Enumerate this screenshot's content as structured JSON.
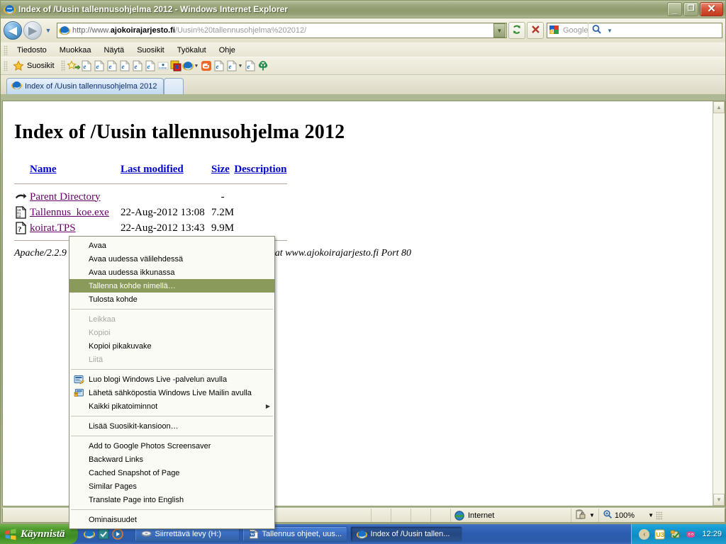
{
  "window": {
    "title": "Index of /Uusin tallennusohjelma 2012 - Windows Internet Explorer",
    "minimize_label": "_",
    "maximize_label": "❐",
    "close_label": "✕"
  },
  "nav": {
    "back_label": "◀",
    "forward_label": "▶",
    "history_caret": "▼",
    "address_prefix": "http://www.",
    "address_domain": "ajokoirajarjesto.fi",
    "address_path": "/Uusin%20tallennusohjelma%202012/",
    "address_dropdown_caret": "▼",
    "refresh_icon": "refresh-icon",
    "stop_icon": "stop-icon",
    "search_placeholder": "Google",
    "search_go_caret": "▼"
  },
  "menubar": {
    "items": [
      {
        "label": "Tiedosto"
      },
      {
        "label": "Muokkaa"
      },
      {
        "label": "Näytä"
      },
      {
        "label": "Suosikit"
      },
      {
        "label": "Työkalut"
      },
      {
        "label": "Ohje"
      }
    ]
  },
  "favbar": {
    "label": "Suosikit",
    "star_icon": "star-icon",
    "items": [
      {
        "icon": "add-favorites-icon"
      },
      {
        "icon": "ie-page-icon"
      },
      {
        "icon": "ie-page-icon"
      },
      {
        "icon": "ie-page-icon"
      },
      {
        "icon": "ie-page-icon"
      },
      {
        "icon": "ie-page-icon"
      },
      {
        "icon": "ie-page-icon"
      },
      {
        "icon": "hotbar-icon"
      },
      {
        "icon": "colorwindow-icon"
      },
      {
        "icon": "ie-blue-icon",
        "caret": "▼"
      },
      {
        "icon": "blogger-icon"
      },
      {
        "icon": "ie-page-icon"
      },
      {
        "icon": "ie-page-icon",
        "caret": "▼"
      },
      {
        "icon": "ie-page-icon"
      },
      {
        "icon": "tree-icon"
      }
    ]
  },
  "tabs": {
    "items": [
      {
        "label": "Index of /Uusin tallennusohjelma 2012",
        "icon": "ie-tab-icon",
        "active": true
      }
    ],
    "new_tab_label": ""
  },
  "page": {
    "heading": "Index of /Uusin tallennusohjelma 2012",
    "columns": [
      {
        "label": "Name"
      },
      {
        "label": "Last modified"
      },
      {
        "label": "Size"
      },
      {
        "label": "Description"
      }
    ],
    "rows": [
      {
        "icon": "parent-directory-icon",
        "name": "Parent Directory",
        "modified": "",
        "size": "-",
        "description": ""
      },
      {
        "icon": "binary-file-icon",
        "name": "Tallennus_koe.exe",
        "modified": "22-Aug-2012 13:08",
        "size": "7.2M",
        "description": ""
      },
      {
        "icon": "unknown-file-icon",
        "name": "koirat.TPS",
        "modified": "22-Aug-2012 13:43",
        "size": "9.9M",
        "description": ""
      }
    ],
    "footer": "Apache/2.2.9 (Debian) mod_jk/1.2.18 mod_defensible/1.2 Server at www.ajokoirajarjesto.fi Port 80"
  },
  "context_menu": {
    "groups": [
      {
        "items": [
          {
            "label": "Avaa",
            "state": "normal"
          },
          {
            "label": "Avaa uudessa välilehdessä",
            "state": "normal"
          },
          {
            "label": "Avaa uudessa ikkunassa",
            "state": "normal"
          },
          {
            "label": "Tallenna kohde nimellä…",
            "state": "selected"
          },
          {
            "label": "Tulosta kohde",
            "state": "normal"
          }
        ]
      },
      {
        "items": [
          {
            "label": "Leikkaa",
            "state": "disabled"
          },
          {
            "label": "Kopioi",
            "state": "disabled"
          },
          {
            "label": "Kopioi pikakuvake",
            "state": "normal"
          },
          {
            "label": "Liitä",
            "state": "disabled"
          }
        ]
      },
      {
        "items": [
          {
            "label": "Luo blogi Windows Live -palvelun avulla",
            "state": "normal",
            "icon": "live-writer-icon"
          },
          {
            "label": "Lähetä sähköpostia Windows Live Mailin avulla",
            "state": "normal",
            "icon": "live-mail-icon"
          },
          {
            "label": "Kaikki pikatoiminnot",
            "state": "normal",
            "submenu": "▶"
          }
        ]
      },
      {
        "items": [
          {
            "label": "Lisää Suosikit-kansioon…",
            "state": "normal"
          }
        ]
      },
      {
        "items": [
          {
            "label": "Add to Google Photos Screensaver",
            "state": "normal"
          },
          {
            "label": "Backward Links",
            "state": "normal"
          },
          {
            "label": "Cached Snapshot of Page",
            "state": "normal"
          },
          {
            "label": "Similar Pages",
            "state": "normal"
          },
          {
            "label": "Translate Page into English",
            "state": "normal"
          }
        ]
      },
      {
        "items": [
          {
            "label": "Ominaisuudet",
            "state": "normal"
          }
        ]
      }
    ]
  },
  "statusbar": {
    "zone_label": "Internet",
    "zone_icon": "globe-icon",
    "protected_icon": "protected-mode-icon",
    "protected_caret": "▼",
    "zoom_icon": "zoom-icon",
    "zoom_label": "100%",
    "zoom_caret": "▼"
  },
  "taskbar": {
    "start_label": "Käynnistä",
    "start_icon": "windows-flag-icon",
    "quicklaunch": [
      {
        "icon": "ie-quicklaunch-icon"
      },
      {
        "icon": "teal-app-icon"
      },
      {
        "icon": "media-player-icon"
      }
    ],
    "tasks": [
      {
        "label": "Siirrettävä levy (H:)",
        "icon": "removable-drive-icon",
        "active": false
      },
      {
        "label": "Tallennus ohjeet, uus...",
        "icon": "word-doc-icon",
        "active": false
      },
      {
        "label": "Index of /Uusin tallen...",
        "icon": "ie-task-icon",
        "active": true
      }
    ],
    "tray": {
      "show_hidden_caret": "‹",
      "icons": [
        {
          "icon": "u3-launchpad-icon",
          "label": "U3"
        },
        {
          "icon": "green-shield-icon"
        },
        {
          "icon": "dna-pink-icon"
        }
      ],
      "clock": "12:29"
    }
  },
  "colors": {
    "titlebar_green": "#98a379",
    "menu_highlight": "#8a9a5b",
    "link_blue": "#0000cc",
    "link_purple": "#660066",
    "taskbar_blue": "#2c5cb0",
    "start_green": "#4e9c2f",
    "close_red": "#c2391d"
  }
}
